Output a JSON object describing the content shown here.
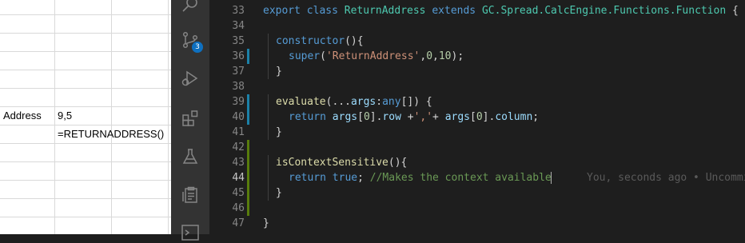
{
  "sheet": {
    "rows": [
      {
        "label": "Address",
        "value": "9,5"
      },
      {
        "label": "",
        "value": "=RETURNADDRESS()"
      }
    ]
  },
  "activity_bar": {
    "icons": [
      "search-icon",
      "source-control-icon",
      "run-debug-icon",
      "extensions-icon",
      "flask-icon",
      "clipboard-icon",
      "terminal-icon"
    ],
    "source_control_badge": "3"
  },
  "editor": {
    "blame_text": "You, seconds ago • Uncommi",
    "lines": [
      {
        "num": "33"
      },
      {
        "num": "34"
      },
      {
        "num": "35"
      },
      {
        "num": "36"
      },
      {
        "num": "37"
      },
      {
        "num": "38"
      },
      {
        "num": "39"
      },
      {
        "num": "40"
      },
      {
        "num": "41"
      },
      {
        "num": "42"
      },
      {
        "num": "43"
      },
      {
        "num": "44"
      },
      {
        "num": "45"
      },
      {
        "num": "46"
      },
      {
        "num": "47"
      }
    ],
    "tokens": {
      "l33": {
        "t1": "export",
        "t2": "class",
        "t3": "ReturnAddress",
        "t4": "extends",
        "t5": "GC.Spread.CalcEngine.Functions.Function",
        "t6": " {"
      },
      "l35": {
        "t1": "constructor",
        "t2": "(){"
      },
      "l36": {
        "t1": "super",
        "t2": "(",
        "t3": "'ReturnAddress'",
        "t4": ",",
        "t5": "0",
        "t6": ",",
        "t7": "10",
        "t8": ");"
      },
      "l37": {
        "t1": "}"
      },
      "l39": {
        "t1": "evaluate",
        "t2": "(...",
        "t3": "args",
        "t4": ":",
        "t5": "any",
        "t6": "[]) {"
      },
      "l40": {
        "t1": "return",
        "t2": "args",
        "t3": "[",
        "t4": "0",
        "t5": "].",
        "t6": "row",
        "t7": " +",
        "t8": "','",
        "t9": "+ ",
        "t10": "args",
        "t11": "[",
        "t12": "0",
        "t13": "].",
        "t14": "column",
        "t15": ";"
      },
      "l41": {
        "t1": "}"
      },
      "l43": {
        "t1": "isContextSensitive",
        "t2": "(){"
      },
      "l44": {
        "t1": "return",
        "t2": "true",
        "t3": ";",
        "t4": "//Makes the context available"
      },
      "l45": {
        "t1": "}"
      },
      "l47": {
        "t1": "}"
      }
    },
    "colors": {
      "modified_gutter": "#1b81a8",
      "added_gutter": "#587c0c"
    }
  }
}
